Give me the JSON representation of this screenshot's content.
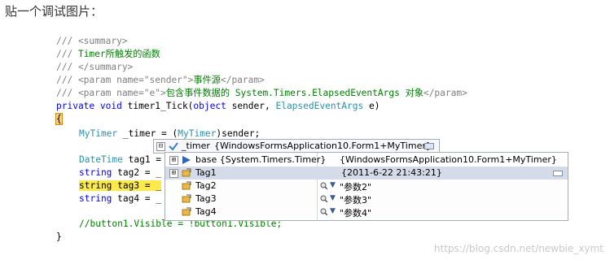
{
  "heading": "贴一个调试图片：",
  "code": {
    "doc1": "/// <summary>",
    "doc2_prefix": "/// ",
    "doc2_text": "Timer所触发的函数",
    "doc3": "/// </summary>",
    "doc4_prefix": "/// <param name=\"sender\">",
    "doc4_text": "事件源",
    "doc4_suffix": "</param>",
    "doc5_prefix": "/// <param name=\"e\">",
    "doc5_text": "包含事件数据的 System.Timers.ElapsedEventArgs 对象",
    "doc5_suffix": "</param>",
    "sig_private": "private",
    "sig_void": "void",
    "sig_mid": " timer1_Tick(",
    "sig_object": "object",
    "sig_sender": " sender, ",
    "sig_type": "ElapsedEventArgs",
    "sig_end": " e)",
    "open_brace": "{",
    "l1_type": "MyTimer",
    "l1_mid": " _timer = (",
    "l1_cast": "MyTimer",
    "l1_end": ")sender;",
    "l2_type": "DateTime",
    "l2_rest": " tag1 = _",
    "l3_kw": "string",
    "l3_rest": " tag2 = _",
    "l4_kw": "string",
    "l4_rest": " tag3 = _",
    "l5_kw": "string",
    "l5_rest": " tag4 = _",
    "comment": "//button1.Visible = !button1.Visible;",
    "close_brace": "}"
  },
  "tooltip": {
    "expand": "⊟",
    "name": "_timer",
    "value": "{WindowsFormsApplication10.Form1+MyTimer}"
  },
  "rows": [
    {
      "expand": "⊞",
      "name": "base {System.Timers.Timer}",
      "value": "{WindowsFormsApplication10.Form1+MyTimer}"
    },
    {
      "expand": "⊞",
      "name": "Tag1",
      "value": "{2011-6-22 21:43:21}"
    },
    {
      "expand": "",
      "name": "Tag2",
      "value": "\"参数2\""
    },
    {
      "expand": "",
      "name": "Tag3",
      "value": "\"参数3\""
    },
    {
      "expand": "",
      "name": "Tag4",
      "value": "\"参数4\""
    }
  ],
  "watermark": "https://blog.csdn.net/newbie_xymt",
  "colors": {
    "comment": "#008000",
    "keyword": "#0000ff",
    "type": "#2b91af",
    "line_highlight": "#fbe94e",
    "selected_row": "#d6dbe9"
  }
}
